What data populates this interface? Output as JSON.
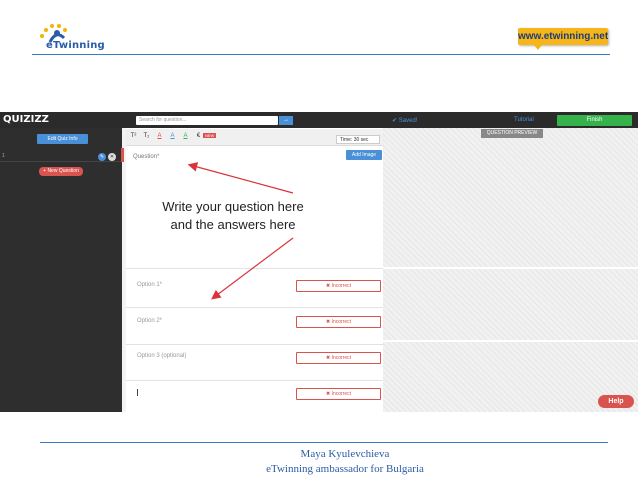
{
  "slide": {
    "logo_text": "eTwinning",
    "url_badge": "www.etwinning.net",
    "annotation_line1": "Write your question here",
    "annotation_line2": "and the answers here",
    "footer_name": "Maya Kyulevchieva",
    "footer_role": "eTwinning ambassador for Bulgaria"
  },
  "app": {
    "brand": "QUIZIZZ",
    "search_placeholder": "Search for question...",
    "search_button": "→",
    "saved": "✔ Saved!",
    "tutorial": "Tutorial",
    "finish": "Finish",
    "edit_quiz_info": "Edit Quiz Info",
    "new_question": "+ New Question",
    "sidebar_index": "1",
    "toolbar": {
      "buttons": [
        "T²",
        "T₂",
        "A",
        "A",
        "A",
        "€"
      ],
      "new_badge": "NEW",
      "timer": "Time: 30 sec"
    },
    "question_label": "Question*",
    "add_image": "Add Image",
    "options": [
      {
        "label": "Option 1*",
        "status": "✖ Incorrect"
      },
      {
        "label": "Option 2*",
        "status": "✖ Incorrect"
      },
      {
        "label": "Option 3 (optional)",
        "status": "✖ Incorrect"
      },
      {
        "label": "",
        "status": "✖ Incorrect"
      }
    ],
    "question_preview": "QUESTION PREVIEW",
    "help": "Help"
  },
  "colors": {
    "accent_blue": "#4a90d9",
    "finish_green": "#35b34a",
    "incorrect_red": "#d9534f",
    "annotation_arrow": "#d9343a"
  }
}
